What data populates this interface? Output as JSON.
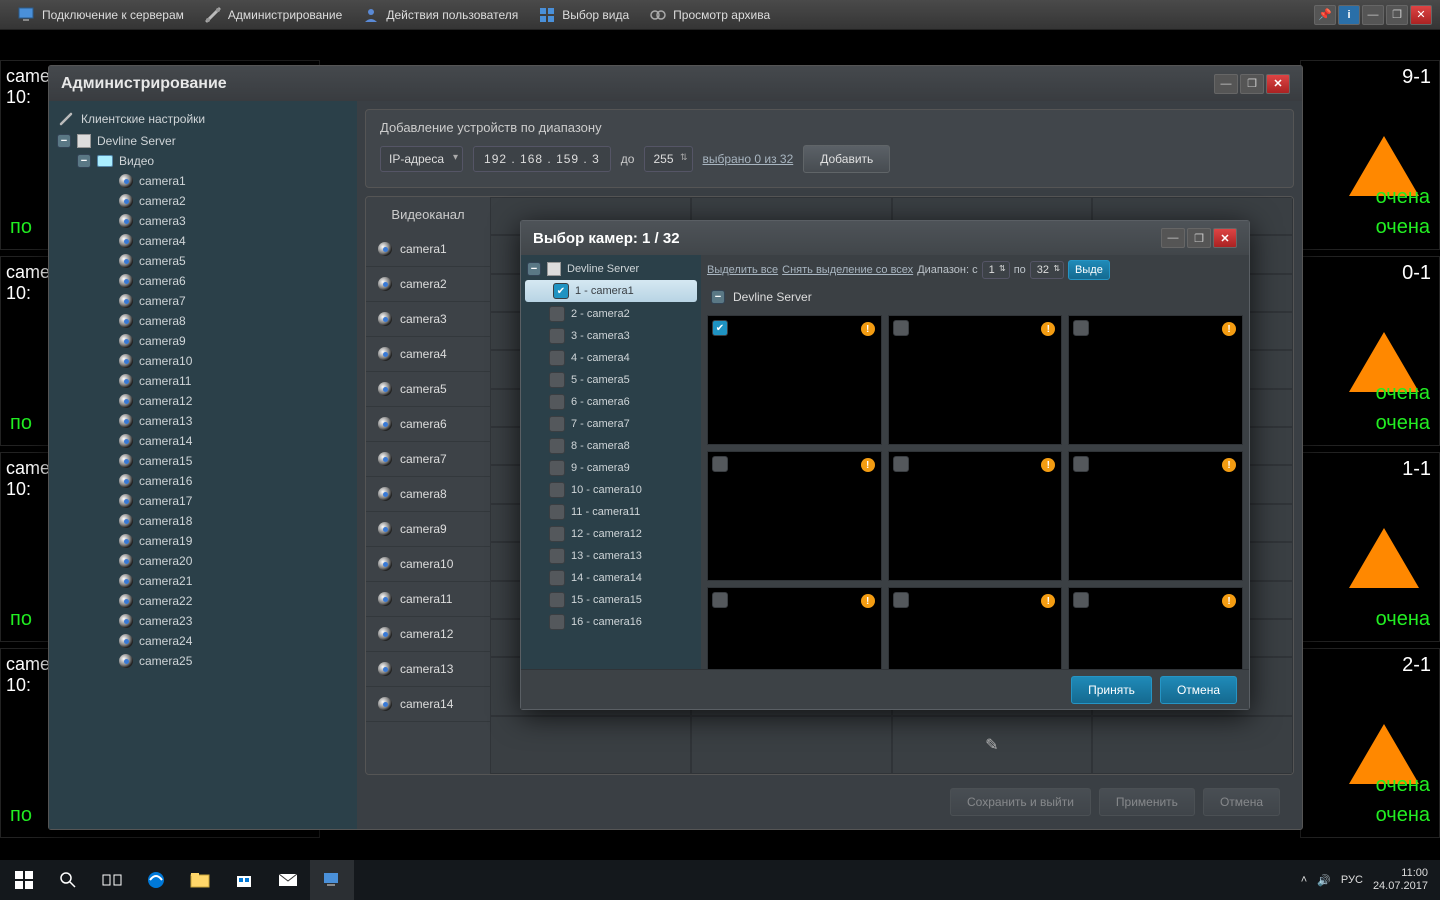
{
  "topbar": {
    "connect": "Подключение к серверам",
    "admin": "Администрирование",
    "user_actions": "Действия пользователя",
    "view_select": "Выбор вида",
    "archive": "Просмотр архива"
  },
  "bg": {
    "cam_label_a": "came",
    "cam_time": "10:",
    "num_right_1": "9-1",
    "num_right_2": "0-1",
    "num_right_3": "1-1",
    "num_right_4": "2-1",
    "overlay_word": "очена",
    "green_left": "по"
  },
  "admin": {
    "title": "Администрирование",
    "client_settings": "Клиентские настройки",
    "server": "Devline Server",
    "video": "Видео",
    "cameras": [
      "camera1",
      "camera2",
      "camera3",
      "camera4",
      "camera5",
      "camera6",
      "camera7",
      "camera8",
      "camera9",
      "camera10",
      "camera11",
      "camera12",
      "camera13",
      "camera14",
      "camera15",
      "camera16",
      "camera17",
      "camera18",
      "camera19",
      "camera20",
      "camera21",
      "camera22",
      "camera23",
      "camera24",
      "camera25"
    ]
  },
  "range": {
    "title": "Добавление устройств по диапазону",
    "mode": "IP-адреса",
    "ip": "192 . 168 . 159 .   3",
    "to": "до",
    "to_val": "255",
    "selected": "выбрано 0 из 32",
    "add": "Добавить"
  },
  "vc": {
    "header": "Видеоканал",
    "items": [
      "camera1",
      "camera2",
      "camera3",
      "camera4",
      "camera5",
      "camera6",
      "camera7",
      "camera8",
      "camera9",
      "camera10",
      "camera11",
      "camera12",
      "camera13",
      "camera14"
    ]
  },
  "footer": {
    "save_exit": "Сохранить и выйти",
    "apply": "Применить",
    "cancel": "Отмена"
  },
  "modal": {
    "title": "Выбор камер: 1 / 32",
    "server": "Devline Server",
    "cameras": [
      "1 - camera1",
      "2 - camera2",
      "3 - camera3",
      "4 - camera4",
      "5 - camera5",
      "6 - camera6",
      "7 - camera7",
      "8 - camera8",
      "9 - camera9",
      "10 - camera10",
      "11 - camera11",
      "12 - camera12",
      "13 - camera13",
      "14 - camera14",
      "15 - camera15",
      "16 - camera16"
    ],
    "select_all": "Выделить все",
    "deselect_all": "Снять выделение со всех",
    "range_label": "Диапазон: с",
    "range_to": "по",
    "range_from": "1",
    "range_to_val": "32",
    "range_btn": "Выде",
    "accept": "Принять",
    "cancel": "Отмена"
  },
  "tray": {
    "lang": "РУС",
    "time": "11:00",
    "date": "24.07.2017"
  }
}
